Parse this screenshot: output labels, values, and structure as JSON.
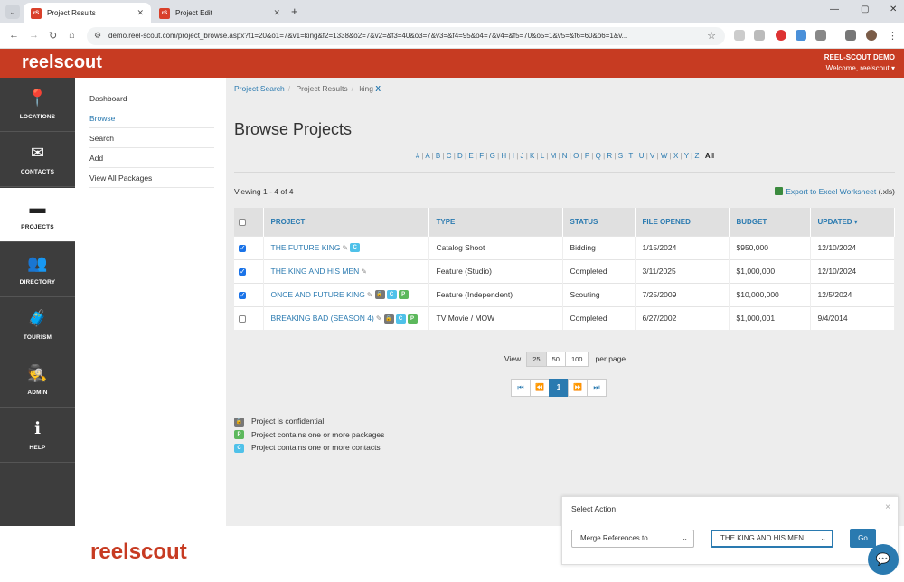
{
  "browser": {
    "tabs": [
      {
        "title": "Project Results",
        "favicon": "rS"
      },
      {
        "title": "Project Edit",
        "favicon": "rS"
      }
    ],
    "url": "demo.reel-scout.com/project_browse.aspx?f1=20&o1=7&v1=king&f2=1338&o2=7&v2=&f3=40&o3=7&v3=&f4=95&o4=7&v4=&f5=70&o5=1&v5=&f6=60&o6=1&v..."
  },
  "site": {
    "logo": "reelscout",
    "account": "REEL-SCOUT DEMO",
    "welcome": "Welcome, reelscout ▾"
  },
  "leftnav": [
    {
      "label": "LOCATIONS",
      "icon": "map-pin-icon",
      "glyph": "📍"
    },
    {
      "label": "CONTACTS",
      "icon": "envelope-icon",
      "glyph": "✉"
    },
    {
      "label": "PROJECTS",
      "icon": "archive-box-icon",
      "glyph": "▬"
    },
    {
      "label": "DIRECTORY",
      "icon": "people-icon",
      "glyph": "👥"
    },
    {
      "label": "TOURISM",
      "icon": "suitcase-icon",
      "glyph": "🧳"
    },
    {
      "label": "ADMIN",
      "icon": "admin-user-icon",
      "glyph": "🕵"
    },
    {
      "label": "HELP",
      "icon": "info-icon",
      "glyph": "ℹ"
    }
  ],
  "submenu": [
    "Dashboard",
    "Browse",
    "Search",
    "Add",
    "View All Packages"
  ],
  "breadcrumb": {
    "items": [
      "Project Search",
      "Project Results"
    ],
    "filter": "king",
    "remove": "X"
  },
  "page_title": "Browse Projects",
  "alphabet": [
    "#",
    "A",
    "B",
    "C",
    "D",
    "E",
    "F",
    "G",
    "H",
    "I",
    "J",
    "K",
    "L",
    "M",
    "N",
    "O",
    "P",
    "Q",
    "R",
    "S",
    "T",
    "U",
    "V",
    "W",
    "X",
    "Y",
    "Z"
  ],
  "alphabet_all": "All",
  "viewing": "Viewing 1 - 4 of 4",
  "export": {
    "label": "Export to Excel Worksheet",
    "suffix": "(.xls)"
  },
  "table": {
    "columns": [
      "PROJECT",
      "TYPE",
      "STATUS",
      "FILE OPENED",
      "BUDGET",
      "UPDATED ▾"
    ],
    "rows": [
      {
        "checked": true,
        "project": "THE FUTURE KING",
        "badges": [
          "C"
        ],
        "lock": false,
        "type": "Catalog Shoot",
        "status": "Bidding",
        "opened": "1/15/2024",
        "budget": "$950,000",
        "updated": "12/10/2024"
      },
      {
        "checked": true,
        "project": "THE KING AND HIS MEN",
        "badges": [],
        "lock": false,
        "type": "Feature (Studio)",
        "status": "Completed",
        "opened": "3/11/2025",
        "budget": "$1,000,000",
        "updated": "12/10/2024"
      },
      {
        "checked": true,
        "project": "ONCE AND FUTURE KING",
        "badges": [
          "C",
          "P"
        ],
        "lock": true,
        "type": "Feature (Independent)",
        "status": "Scouting",
        "opened": "7/25/2009",
        "budget": "$10,000,000",
        "updated": "12/5/2024"
      },
      {
        "checked": false,
        "project": "BREAKING BAD (SEASON 4)",
        "badges": [
          "C",
          "P"
        ],
        "lock": true,
        "type": "TV Movie / MOW",
        "status": "Completed",
        "opened": "6/27/2002",
        "budget": "$1,000,001",
        "updated": "9/4/2014"
      }
    ]
  },
  "pager": {
    "view_label": "View",
    "sizes": [
      "25",
      "50",
      "100"
    ],
    "selected_size": "25",
    "per_page": "per page",
    "current_page": "1",
    "first": "⏮",
    "prev": "⏪",
    "next": "⏩",
    "last": "⏭"
  },
  "legend": [
    {
      "badge": "lock",
      "text": "Project is confidential"
    },
    {
      "badge": "P",
      "text": "Project contains one or more packages"
    },
    {
      "badge": "C",
      "text": "Project contains one or more contacts"
    }
  ],
  "action_panel": {
    "title": "Select Action",
    "close": "×",
    "action_value": "Merge References to",
    "target_value": "THE KING AND HIS MEN",
    "go": "Go"
  },
  "footer_logo": "reelscout",
  "colors": {
    "brand": "#c73b22",
    "link": "#2a7ab0",
    "nav_bg": "#3d3d3d",
    "badge_c": "#4fc1e9",
    "badge_p": "#5cb85c"
  }
}
